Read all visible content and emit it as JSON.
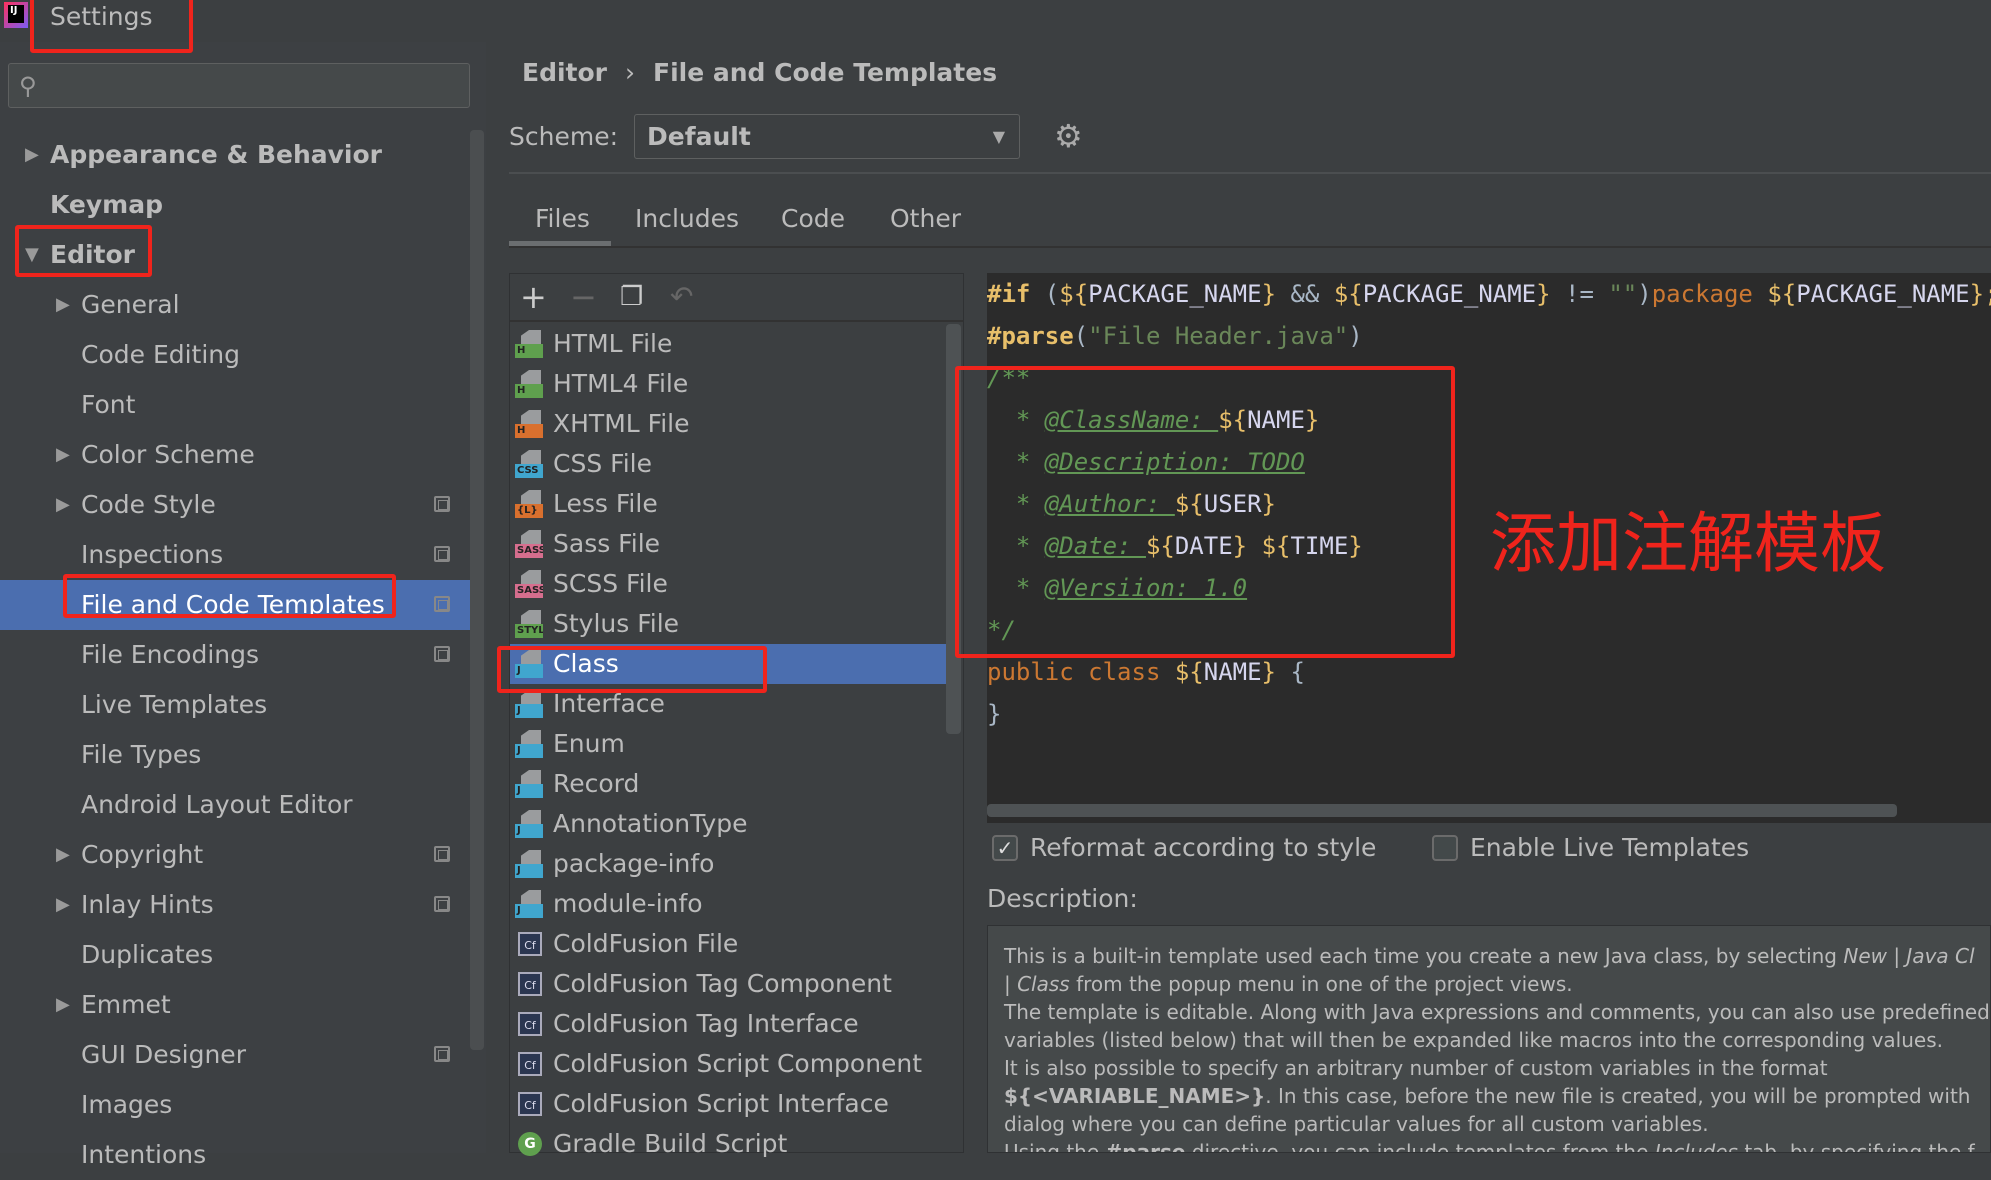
{
  "window": {
    "title": "Settings"
  },
  "sidebar": {
    "search_placeholder": "",
    "items": [
      {
        "label": "Appearance & Behavior",
        "level": 0,
        "arrow": "right",
        "bold": true
      },
      {
        "label": "Keymap",
        "level": 0,
        "bold": true
      },
      {
        "label": "Editor",
        "level": 0,
        "arrow": "down",
        "bold": true
      },
      {
        "label": "General",
        "level": 1,
        "arrow": "right"
      },
      {
        "label": "Code Editing",
        "level": 1
      },
      {
        "label": "Font",
        "level": 1
      },
      {
        "label": "Color Scheme",
        "level": 1,
        "arrow": "right"
      },
      {
        "label": "Code Style",
        "level": 1,
        "arrow": "right",
        "copy": true
      },
      {
        "label": "Inspections",
        "level": 1,
        "copy": true
      },
      {
        "label": "File and Code Templates",
        "level": 1,
        "copy": true,
        "selected": true
      },
      {
        "label": "File Encodings",
        "level": 1,
        "copy": true
      },
      {
        "label": "Live Templates",
        "level": 1
      },
      {
        "label": "File Types",
        "level": 1
      },
      {
        "label": "Android Layout Editor",
        "level": 1
      },
      {
        "label": "Copyright",
        "level": 1,
        "arrow": "right",
        "copy": true
      },
      {
        "label": "Inlay Hints",
        "level": 1,
        "arrow": "right",
        "copy": true
      },
      {
        "label": "Duplicates",
        "level": 1
      },
      {
        "label": "Emmet",
        "level": 1,
        "arrow": "right"
      },
      {
        "label": "GUI Designer",
        "level": 1,
        "copy": true
      },
      {
        "label": "Images",
        "level": 1
      },
      {
        "label": "Intentions",
        "level": 1
      }
    ]
  },
  "breadcrumb": [
    "Editor",
    "File and Code Templates"
  ],
  "breadcrumb_sep": "›",
  "scheme": {
    "label": "Scheme:",
    "value": "Default"
  },
  "tabs": [
    {
      "label": "Files",
      "active": true
    },
    {
      "label": "Includes"
    },
    {
      "label": "Code"
    },
    {
      "label": "Other"
    }
  ],
  "templates": [
    {
      "label": "HTML File",
      "badge": "H",
      "color": "#5fa04e"
    },
    {
      "label": "HTML4 File",
      "badge": "H",
      "color": "#5fa04e"
    },
    {
      "label": "XHTML File",
      "badge": "H",
      "color": "#d9702e"
    },
    {
      "label": "CSS File",
      "badge": "CSS",
      "color": "#40a6ce"
    },
    {
      "label": "Less File",
      "badge": "{L}",
      "color": "#d9702e"
    },
    {
      "label": "Sass File",
      "badge": "SASS",
      "color": "#d66e8e"
    },
    {
      "label": "SCSS File",
      "badge": "SASS",
      "color": "#d66e8e"
    },
    {
      "label": "Stylus File",
      "badge": "STYL",
      "color": "#5fa04e"
    },
    {
      "label": "Class",
      "badge": "J",
      "color": "#40a6ce",
      "selected": true
    },
    {
      "label": "Interface",
      "badge": "J",
      "color": "#40a6ce"
    },
    {
      "label": "Enum",
      "badge": "J",
      "color": "#40a6ce"
    },
    {
      "label": "Record",
      "badge": "J",
      "color": "#40a6ce"
    },
    {
      "label": "AnnotationType",
      "badge": "J",
      "color": "#40a6ce"
    },
    {
      "label": "package-info",
      "badge": "J",
      "color": "#40a6ce"
    },
    {
      "label": "module-info",
      "badge": "J",
      "color": "#40a6ce"
    },
    {
      "label": "ColdFusion File",
      "icon": "cf"
    },
    {
      "label": "ColdFusion Tag Component",
      "icon": "cf"
    },
    {
      "label": "ColdFusion Tag Interface",
      "icon": "cf"
    },
    {
      "label": "ColdFusion Script Component",
      "icon": "cf"
    },
    {
      "label": "ColdFusion Script Interface",
      "icon": "cf"
    },
    {
      "label": "Gradle Build Script",
      "icon": "gradle"
    }
  ],
  "code": [
    [
      [
        "#if",
        "dir"
      ],
      [
        " (",
        "op"
      ],
      [
        "${",
        "var"
      ],
      [
        "PACKAGE_NAME",
        "vn"
      ],
      [
        "}",
        "var"
      ],
      [
        " && ",
        "op"
      ],
      [
        "${",
        "var"
      ],
      [
        "PACKAGE_NAME",
        "vn"
      ],
      [
        "}",
        "var"
      ],
      [
        " != ",
        "op"
      ],
      [
        "\"\"",
        "str"
      ],
      [
        ")",
        "op"
      ],
      [
        "package",
        "kw"
      ],
      [
        " ",
        "op"
      ],
      [
        "${",
        "var"
      ],
      [
        "PACKAGE_NAME",
        "vn"
      ],
      [
        "};",
        "var"
      ]
    ],
    [
      [
        "#parse",
        "dir"
      ],
      [
        "(",
        "op"
      ],
      [
        "\"File Header.java\"",
        "str"
      ],
      [
        ")",
        "op"
      ]
    ],
    [
      [
        "/**",
        "cm"
      ]
    ],
    [
      [
        "  * ",
        "cm"
      ],
      [
        "@ClassName: ",
        "tag"
      ],
      [
        "${",
        "var"
      ],
      [
        "NAME",
        "vn"
      ],
      [
        "}",
        "var"
      ]
    ],
    [
      [
        "  * ",
        "cm"
      ],
      [
        "@Description: TODO",
        "tag"
      ]
    ],
    [
      [
        "  * ",
        "cm"
      ],
      [
        "@Author: ",
        "tag"
      ],
      [
        "${",
        "var"
      ],
      [
        "USER",
        "vn"
      ],
      [
        "}",
        "var"
      ]
    ],
    [
      [
        "  * ",
        "cm"
      ],
      [
        "@Date: ",
        "tag"
      ],
      [
        "${",
        "var"
      ],
      [
        "DATE",
        "vn"
      ],
      [
        "}",
        "var"
      ],
      [
        " ",
        "op"
      ],
      [
        "${",
        "var"
      ],
      [
        "TIME",
        "vn"
      ],
      [
        "}",
        "var"
      ]
    ],
    [
      [
        "  * ",
        "cm"
      ],
      [
        "@Versiion: 1.0",
        "tag"
      ]
    ],
    [
      [
        "*/",
        "cm"
      ]
    ],
    [
      [
        "public class ",
        "kw"
      ],
      [
        "${",
        "var"
      ],
      [
        "NAME",
        "vn"
      ],
      [
        "}",
        "var"
      ],
      [
        " {",
        "op"
      ]
    ],
    [
      [
        "}",
        "op"
      ]
    ]
  ],
  "options": {
    "reformat": {
      "label": "Reformat according to style",
      "checked": true
    },
    "live_templates": {
      "label": "Enable Live Templates",
      "checked": false
    }
  },
  "description": {
    "label": "Description:",
    "lines": [
      "This is a built-in template used each time you create a new Java class, by selecting <i>New | Java Cl</i>",
      "<i>| Class</i> from the popup menu in one of the project views.",
      "The template is editable. Along with Java expressions and comments, you can also use predefined",
      "variables (listed below) that will then be expanded like macros into the corresponding values.",
      "It is also possible to specify an arbitrary number of custom variables in the format",
      "<b>${&lt;VARIABLE_NAME&gt;}</b>. In this case, before the new file is created, you will be prompted with",
      "dialog where you can define particular values for all custom variables.",
      "Using the <b>#parse</b> directive, you can include templates from the <i>Includes</i> tab, by specifying the f"
    ]
  },
  "annotation": {
    "text": "添加注解模板",
    "color": "#f0241c"
  }
}
